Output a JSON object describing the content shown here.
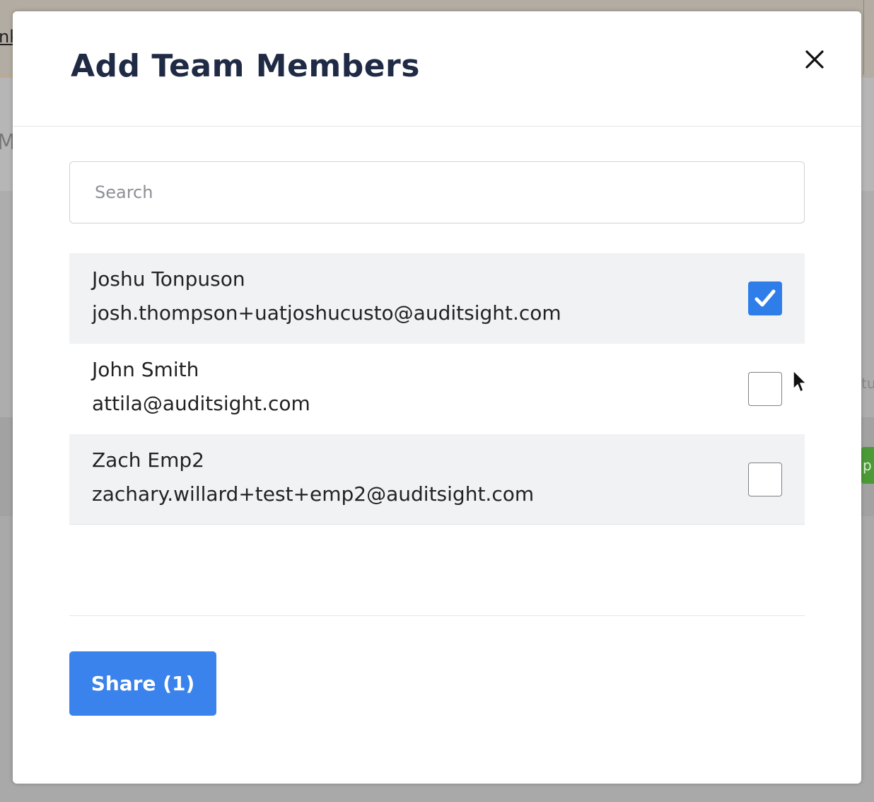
{
  "background": {
    "link_fragment": "nk",
    "letter_fragment": "M",
    "right_text_fragment": "tu",
    "button_fragment": "p"
  },
  "modal": {
    "title": "Add Team Members",
    "close_icon": "close-icon",
    "search": {
      "placeholder": "Search",
      "value": ""
    },
    "members": [
      {
        "name": "Joshu Tonpuson",
        "email": "josh.thompson+uatjoshucusto@auditsight.com",
        "checked": true
      },
      {
        "name": "John Smith",
        "email": "attila@auditsight.com",
        "checked": false
      },
      {
        "name": "Zach Emp2",
        "email": "zachary.willard+test+emp2@auditsight.com",
        "checked": false
      }
    ],
    "share_label": "Share (1)"
  },
  "colors": {
    "accent": "#3a82ec",
    "title": "#1f2a44",
    "row_shade": "#f1f2f4"
  }
}
